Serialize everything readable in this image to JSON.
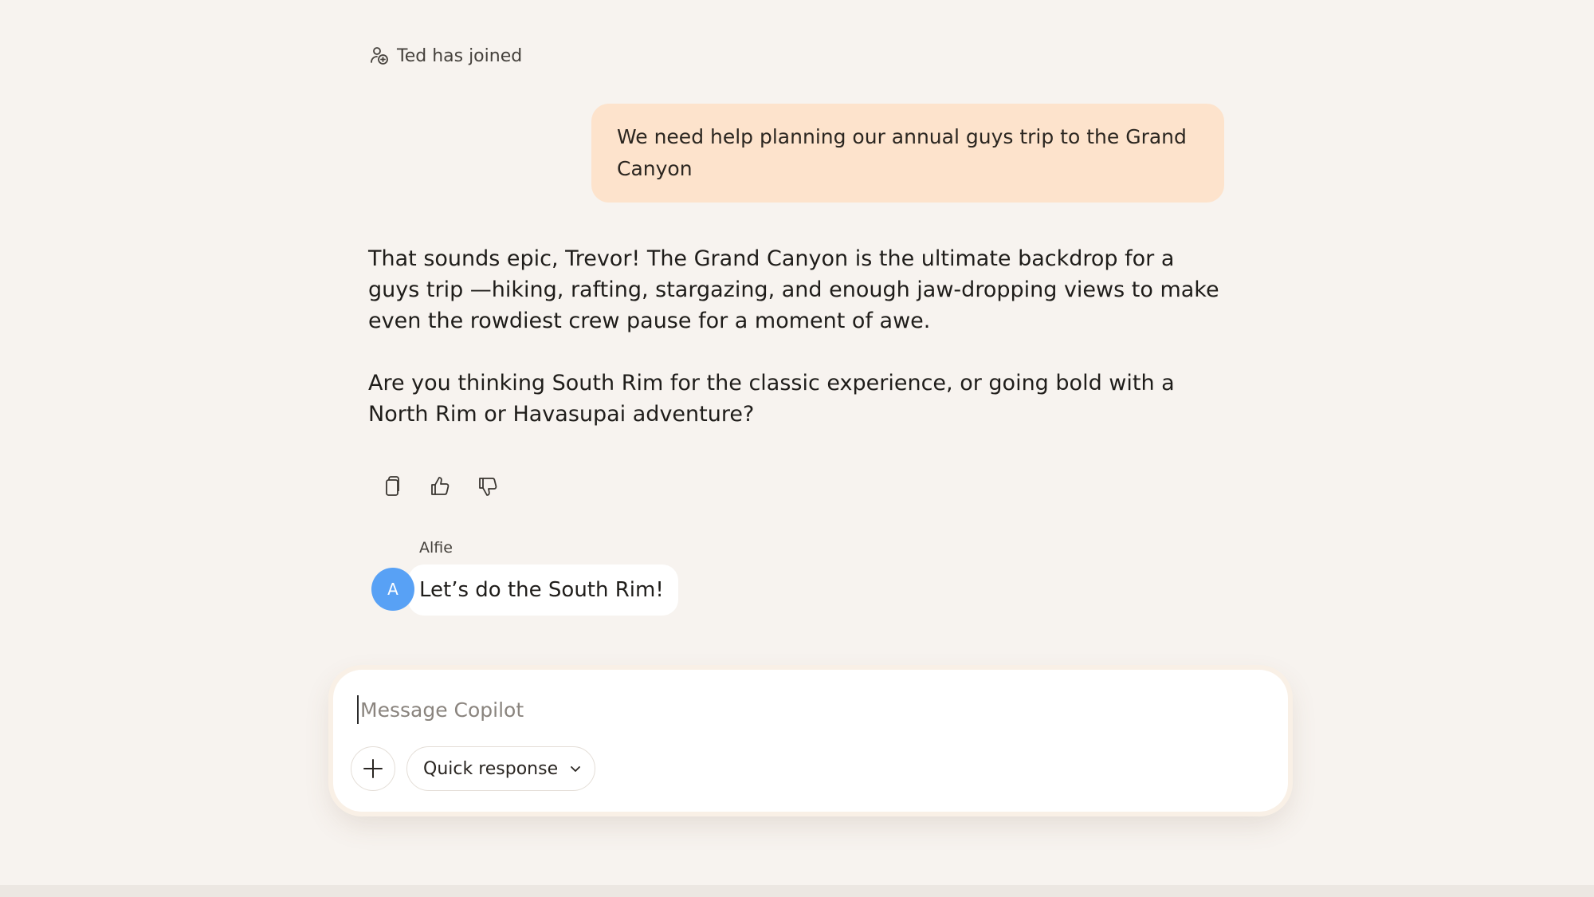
{
  "system": {
    "join_notice": "Ted has joined"
  },
  "conversation": {
    "user_message": "We need help planning our annual guys trip to the Grand Canyon",
    "assistant_paragraphs": [
      "That sounds epic, Trevor! The Grand Canyon is the ultimate backdrop for a guys trip —hiking, rafting, stargazing, and enough jaw-dropping views to make even the rowdiest crew pause for a moment of awe.",
      "Are you thinking South Rim for the classic experience, or going bold with a North Rim or Havasupai adventure?"
    ],
    "feedback_icons": [
      "copy-icon",
      "thumbs-up-icon",
      "thumbs-down-icon"
    ],
    "peer_message": {
      "sender": "Alfie",
      "avatar_initial": "A",
      "avatar_color": "#58a1f5",
      "text": "Let’s do the South Rim!"
    }
  },
  "composer": {
    "placeholder": "Message Copilot",
    "value": "",
    "mode_label": "Quick response"
  },
  "colors": {
    "background": "#f7f3ef",
    "user_bubble": "#fde3cc",
    "accent_avatar": "#58a1f5"
  }
}
